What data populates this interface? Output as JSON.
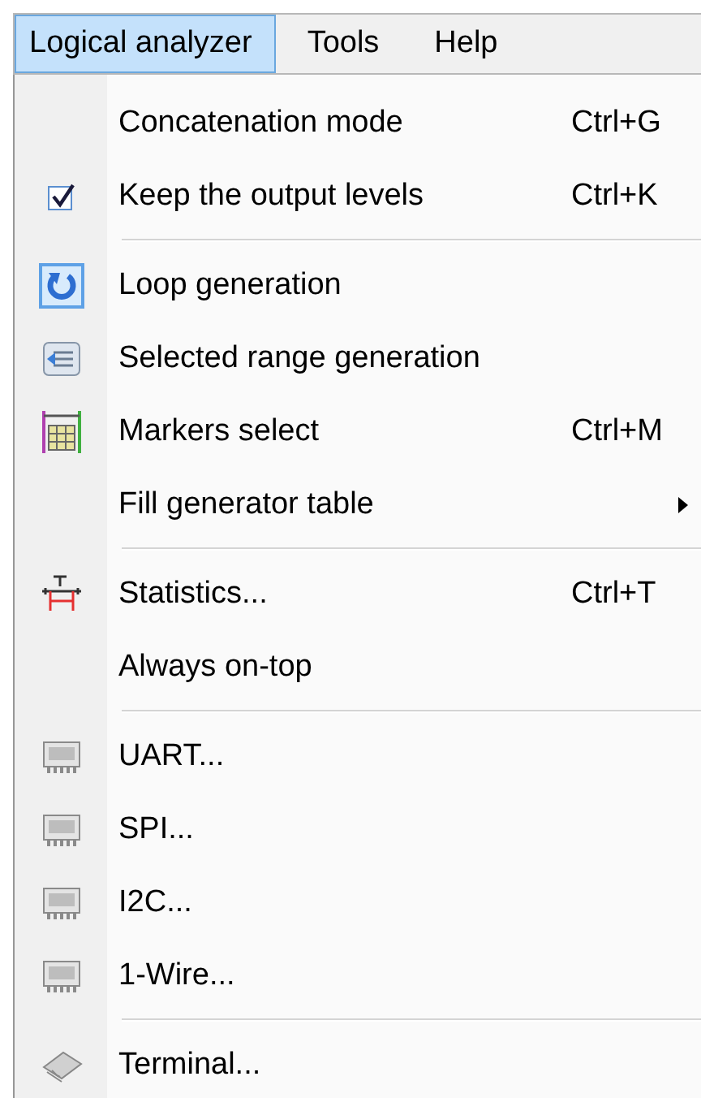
{
  "menu_bar": [
    {
      "label": "Logical analyzer",
      "selected": true
    },
    {
      "label": "Tools",
      "selected": false
    },
    {
      "label": "Help",
      "selected": false
    }
  ],
  "menu": [
    {
      "kind": "item",
      "label": "Concatenation mode",
      "shortcut": "Ctrl+G"
    },
    {
      "kind": "item",
      "label": "Keep the output levels",
      "shortcut": "Ctrl+K",
      "checked": true
    },
    {
      "kind": "separator"
    },
    {
      "kind": "item",
      "label": "Loop generation",
      "checked": true
    },
    {
      "kind": "item",
      "label": "Selected range generation"
    },
    {
      "kind": "item",
      "label": "Markers select",
      "shortcut": "Ctrl+M"
    },
    {
      "kind": "submenu",
      "label": "Fill generator table"
    },
    {
      "kind": "separator"
    },
    {
      "kind": "item",
      "label": "Statistics...",
      "shortcut": "Ctrl+T"
    },
    {
      "kind": "item",
      "label": "Always on-top"
    },
    {
      "kind": "separator"
    },
    {
      "kind": "item",
      "label": "UART..."
    },
    {
      "kind": "item",
      "label": "SPI..."
    },
    {
      "kind": "item",
      "label": "I2C..."
    },
    {
      "kind": "item",
      "label": "1-Wire..."
    },
    {
      "kind": "separator"
    },
    {
      "kind": "item",
      "label": "Terminal..."
    }
  ]
}
